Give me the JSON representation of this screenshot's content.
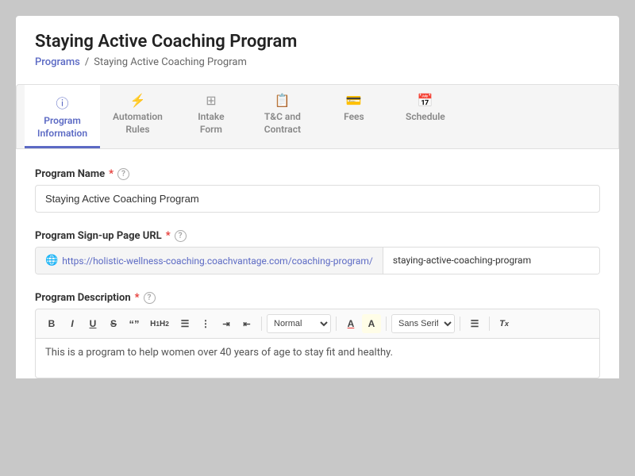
{
  "page": {
    "title": "Staying Active Coaching Program",
    "breadcrumb": {
      "parent_label": "Programs",
      "separator": "/",
      "current": "Staying Active Coaching Program"
    }
  },
  "tabs": [
    {
      "id": "program-information",
      "label": "Program\nInformation",
      "icon": "ℹ",
      "active": true
    },
    {
      "id": "automation-rules",
      "label": "Automation\nRules",
      "icon": "⚡",
      "active": false
    },
    {
      "id": "intake-form",
      "label": "Intake\nForm",
      "icon": "≡",
      "active": false
    },
    {
      "id": "tc-contract",
      "label": "T&C and\nContract",
      "icon": "📄",
      "active": false
    },
    {
      "id": "fees",
      "label": "Fees",
      "icon": "🪙",
      "active": false
    },
    {
      "id": "schedule",
      "label": "Schedule",
      "icon": "📅",
      "active": false
    }
  ],
  "form": {
    "program_name": {
      "label": "Program Name",
      "required": true,
      "value": "Staying Active Coaching Program",
      "placeholder": "Staying Active Coaching Program"
    },
    "signup_url": {
      "label": "Program Sign-up Page URL",
      "required": true,
      "prefix": "🌐 https://holistic-wellness-coaching.coachvantage.com/coaching-program/",
      "suffix": "staying-active-coaching-program"
    },
    "description": {
      "label": "Program Description",
      "required": true,
      "content": "This is a program to help women over 40 years of age to stay fit and healthy."
    }
  },
  "toolbar": {
    "buttons": [
      {
        "id": "bold",
        "label": "B",
        "class": "bold"
      },
      {
        "id": "italic",
        "label": "I",
        "class": "italic"
      },
      {
        "id": "underline",
        "label": "U",
        "class": "underline"
      },
      {
        "id": "strikethrough",
        "label": "S",
        "class": "strike"
      },
      {
        "id": "quote",
        "label": "\"\"",
        "class": ""
      },
      {
        "id": "h1h2",
        "label": "H1 H2",
        "class": "h1-h2-btn"
      },
      {
        "id": "ordered-list",
        "label": "≡",
        "class": ""
      },
      {
        "id": "unordered-list",
        "label": "☰",
        "class": ""
      },
      {
        "id": "indent",
        "label": "⇥≡",
        "class": ""
      },
      {
        "id": "outdent",
        "label": "≡⇤",
        "class": ""
      }
    ],
    "format_select": "Normal",
    "font_color": "A",
    "font_bg": "A",
    "font_family": "Sans Serif",
    "align_icon": "≡",
    "clear_format": "Tx"
  }
}
